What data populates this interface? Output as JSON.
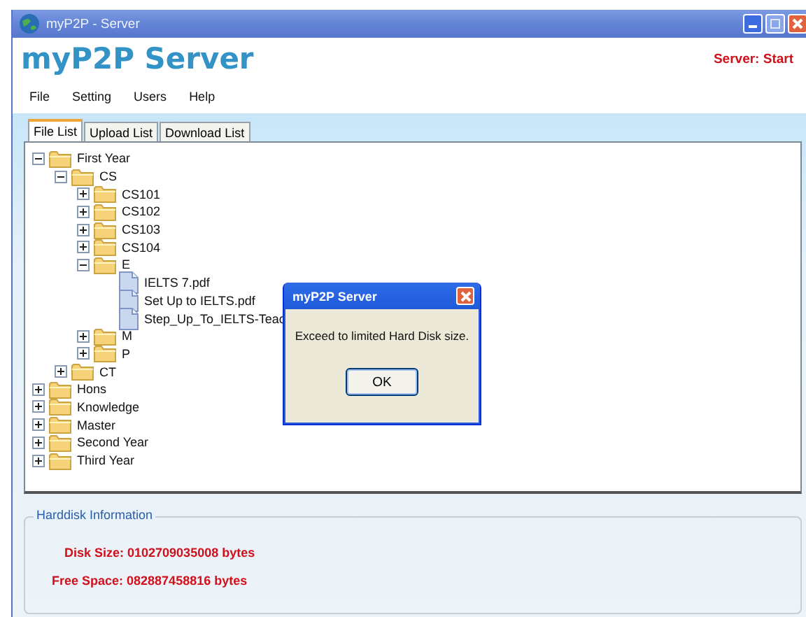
{
  "window": {
    "title": "myP2P - Server"
  },
  "header": {
    "title": "myP2P Server",
    "status": "Server: Start"
  },
  "menu": [
    "File",
    "Setting",
    "Users",
    "Help"
  ],
  "tabs": [
    {
      "label": "File List",
      "selected": true
    },
    {
      "label": "Upload List",
      "selected": false
    },
    {
      "label": "Download List",
      "selected": false
    }
  ],
  "tree": [
    {
      "kind": "folder",
      "label": "First Year",
      "expanded": true,
      "children": [
        {
          "kind": "folder",
          "label": "CS",
          "expanded": true,
          "children": [
            {
              "kind": "folder",
              "label": "CS101",
              "expanded": false
            },
            {
              "kind": "folder",
              "label": "CS102",
              "expanded": false
            },
            {
              "kind": "folder",
              "label": "CS103",
              "expanded": false
            },
            {
              "kind": "folder",
              "label": "CS104",
              "expanded": false
            },
            {
              "kind": "folder",
              "label": "E",
              "expanded": true,
              "children": [
                {
                  "kind": "file",
                  "label": "IELTS 7.pdf"
                },
                {
                  "kind": "file",
                  "label": "Set Up to IELTS.pdf"
                },
                {
                  "kind": "file",
                  "label": "Step_Up_To_IELTS-Teac"
                }
              ]
            },
            {
              "kind": "folder",
              "label": "M",
              "expanded": false
            },
            {
              "kind": "folder",
              "label": "P",
              "expanded": false
            }
          ]
        },
        {
          "kind": "folder",
          "label": "CT",
          "expanded": false
        }
      ]
    },
    {
      "kind": "folder",
      "label": "Hons",
      "expanded": false
    },
    {
      "kind": "folder",
      "label": "Knowledge",
      "expanded": false
    },
    {
      "kind": "folder",
      "label": "Master",
      "expanded": false
    },
    {
      "kind": "folder",
      "label": "Second Year",
      "expanded": false
    },
    {
      "kind": "folder",
      "label": "Third Year",
      "expanded": false
    }
  ],
  "harddisk": {
    "title": "Harddisk Information",
    "disk_size": "Disk Size: 0102709035008 bytes",
    "free_space": "Free Space: 082887458816 bytes"
  },
  "dialog": {
    "title": "myP2P Server",
    "message": "Exceed to limited Hard Disk size.",
    "button": "OK"
  }
}
